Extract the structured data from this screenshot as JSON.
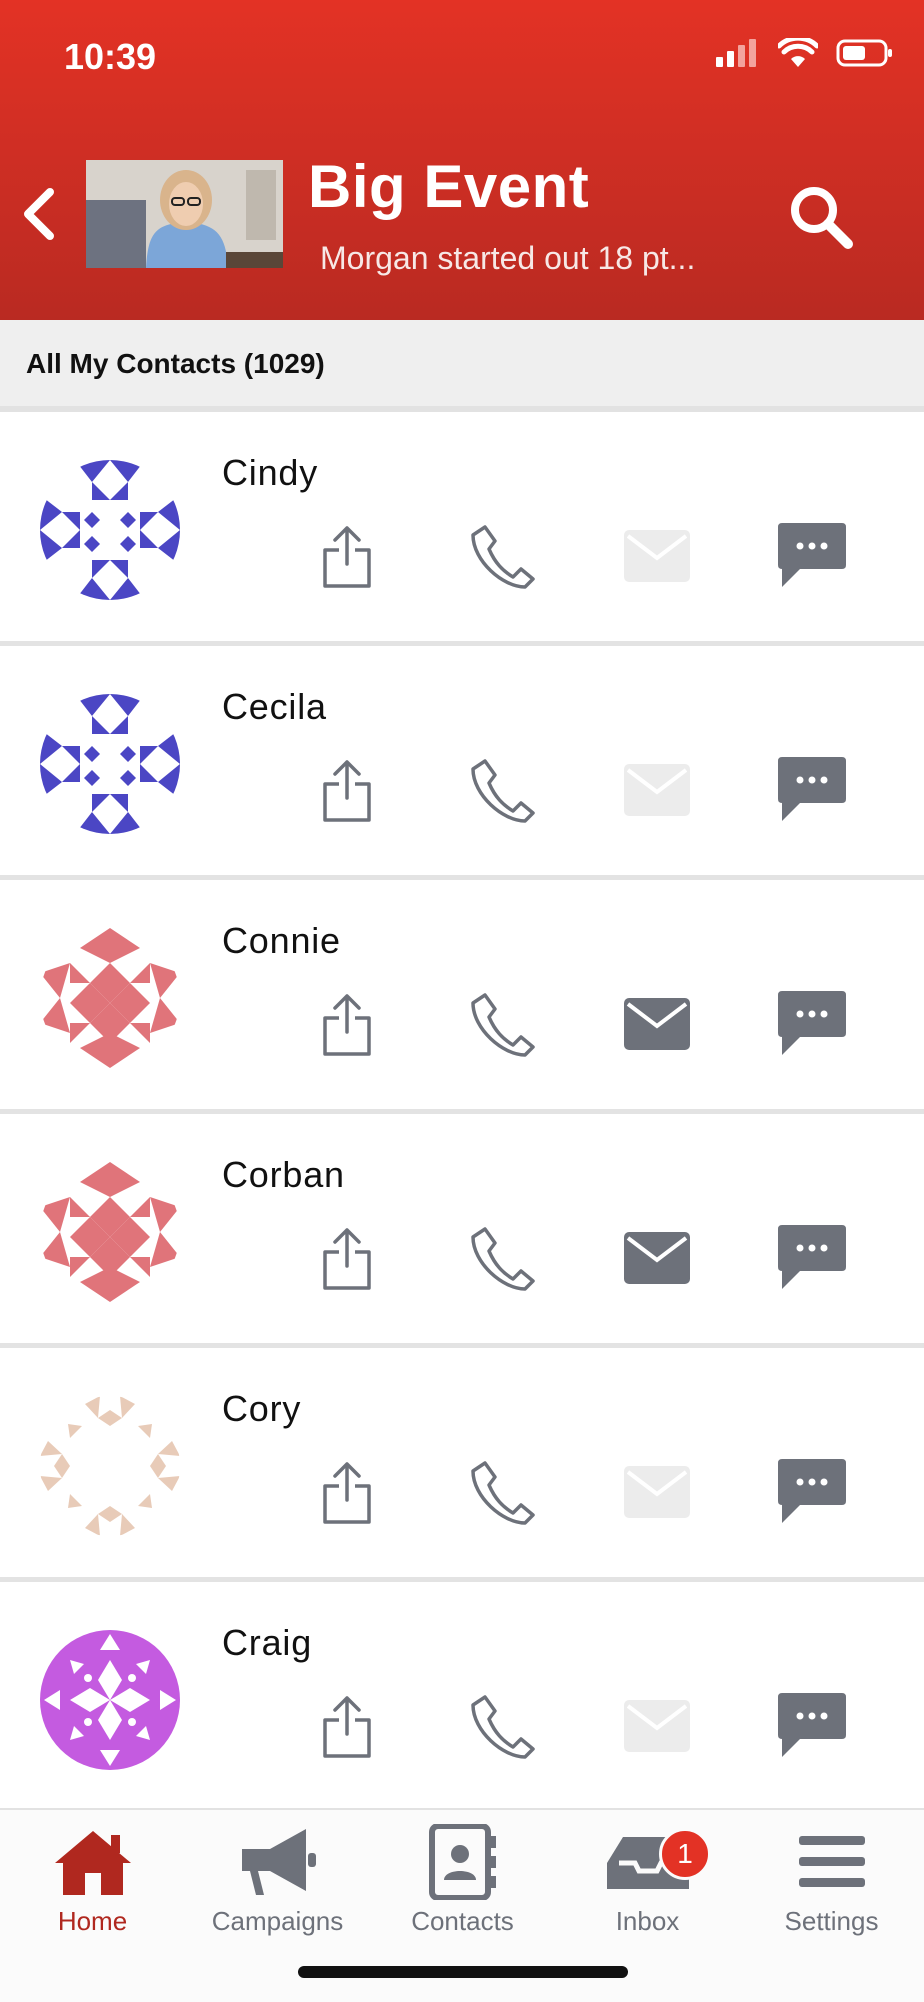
{
  "status_bar": {
    "time": "10:39"
  },
  "header": {
    "title": "Big Event",
    "subtitle": "Morgan started out 18 pt...",
    "bg_color": "#d4302a"
  },
  "section": {
    "title": "All My Contacts (1029)"
  },
  "contacts": [
    {
      "name": "Cindy",
      "avatar": "blue-pattern",
      "email_enabled": false
    },
    {
      "name": "Cecila",
      "avatar": "blue-pattern",
      "email_enabled": false
    },
    {
      "name": "Connie",
      "avatar": "pink-pattern",
      "email_enabled": true
    },
    {
      "name": "Corban",
      "avatar": "pink-pattern",
      "email_enabled": true
    },
    {
      "name": "Cory",
      "avatar": "beige-pattern",
      "email_enabled": false
    },
    {
      "name": "Craig",
      "avatar": "purple-pattern",
      "email_enabled": false
    }
  ],
  "tab_bar": {
    "tabs": [
      {
        "label": "Home",
        "icon": "home-icon",
        "active": true
      },
      {
        "label": "Campaigns",
        "icon": "megaphone-icon"
      },
      {
        "label": "Contacts",
        "icon": "address-book-icon"
      },
      {
        "label": "Inbox",
        "icon": "inbox-icon",
        "badge": "1"
      },
      {
        "label": "Settings",
        "icon": "menu-icon"
      }
    ]
  },
  "colors": {
    "accent": "#e33225",
    "icon_gray": "#6d717a",
    "disabled_gray": "#ececec"
  }
}
